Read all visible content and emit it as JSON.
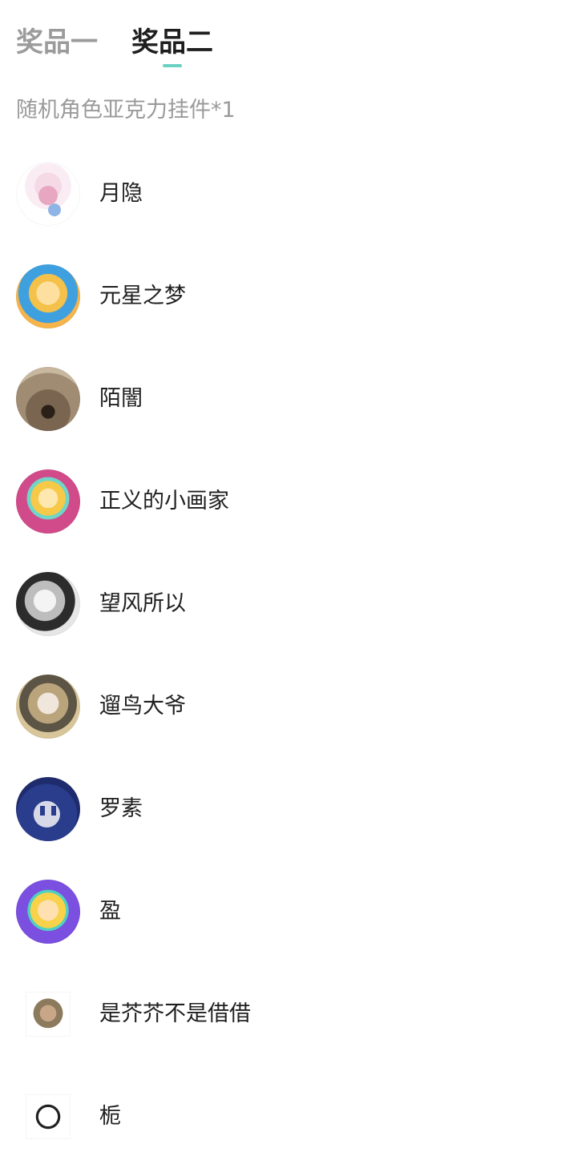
{
  "tabs": [
    {
      "label": "奖品一",
      "active": false
    },
    {
      "label": "奖品二",
      "active": true
    }
  ],
  "accent_color": "#6bd2c3",
  "prize_description": "随机角色亚克力挂件*1",
  "winners": [
    {
      "name": "月隐",
      "avatar_icon": "anime-girl-avatar-icon"
    },
    {
      "name": "元星之梦",
      "avatar_icon": "anime-girl-avatar-icon"
    },
    {
      "name": "陌闇",
      "avatar_icon": "dog-avatar-icon"
    },
    {
      "name": "正义的小画家",
      "avatar_icon": "chibi-avatar-icon"
    },
    {
      "name": "望风所以",
      "avatar_icon": "anime-boy-avatar-icon"
    },
    {
      "name": "遛鸟大爷",
      "avatar_icon": "anime-girl-avatar-icon"
    },
    {
      "name": "罗素",
      "avatar_icon": "robot-avatar-icon"
    },
    {
      "name": "盈",
      "avatar_icon": "chibi-avatar-icon"
    },
    {
      "name": "是芥芥不是借借",
      "avatar_icon": "anime-character-avatar-icon"
    },
    {
      "name": "栀",
      "avatar_icon": "panda-avatar-icon"
    }
  ]
}
